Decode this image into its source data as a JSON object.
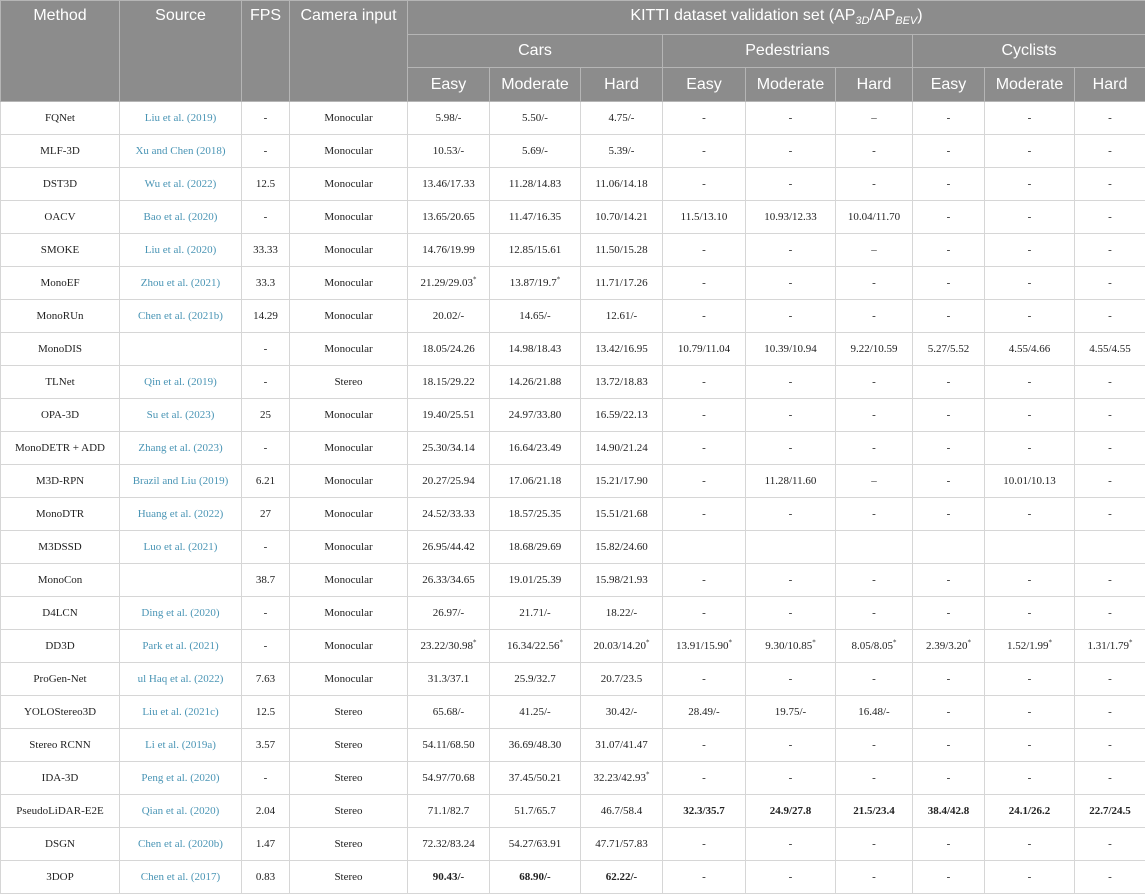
{
  "headers": {
    "method": "Method",
    "source": "Source",
    "fps": "FPS",
    "camera": "Camera input",
    "kitti_prefix": "KITTI dataset validation set (AP",
    "kitti_sub1": "3D",
    "kitti_mid": "/AP",
    "kitti_sub2": "BEV",
    "kitti_suffix": ")",
    "groups": [
      "Cars",
      "Pedestrians",
      "Cyclists"
    ],
    "levels": [
      "Easy",
      "Moderate",
      "Hard",
      "Easy",
      "Moderate",
      "Hard",
      "Easy",
      "Moderate",
      "Hard"
    ]
  },
  "rows": [
    {
      "method": "FQNet",
      "source": "Liu et al. (2019)",
      "fps": "-",
      "camera": "Monocular",
      "values": [
        "5.98/-",
        "5.50/-",
        "4.75/-",
        "-",
        "-",
        "–",
        "-",
        "-",
        "-"
      ],
      "bold": []
    },
    {
      "method": "MLF-3D",
      "source": "Xu and Chen (2018)",
      "fps": "-",
      "camera": "Monocular",
      "values": [
        "10.53/-",
        "5.69/-",
        "5.39/-",
        "-",
        "-",
        "-",
        "-",
        "-",
        "-"
      ],
      "bold": []
    },
    {
      "method": "DST3D",
      "source": "Wu et al. (2022)",
      "fps": "12.5",
      "camera": "Monocular",
      "values": [
        "13.46/17.33",
        "11.28/14.83",
        "11.06/14.18",
        "-",
        "-",
        "-",
        "-",
        "-",
        "-"
      ],
      "bold": []
    },
    {
      "method": "OACV",
      "source": "Bao et al. (2020)",
      "fps": "-",
      "camera": "Monocular",
      "values": [
        "13.65/20.65",
        "11.47/16.35",
        "10.70/14.21",
        "11.5/13.10",
        "10.93/12.33",
        "10.04/11.70",
        "-",
        "-",
        "-"
      ],
      "bold": []
    },
    {
      "method": "SMOKE",
      "source": "Liu et al. (2020)",
      "fps": "33.33",
      "camera": "Monocular",
      "values": [
        "14.76/19.99",
        "12.85/15.61",
        "11.50/15.28",
        "-",
        "-",
        "–",
        "-",
        "-",
        "-"
      ],
      "bold": []
    },
    {
      "method": "MonoEF",
      "source": "Zhou et al. (2021)",
      "fps": "33.3",
      "camera": "Monocular",
      "values": [
        "21.29/29.03*",
        "13.87/19.7*",
        "11.71/17.26",
        "-",
        "-",
        "-",
        "-",
        "-",
        "-"
      ],
      "bold": []
    },
    {
      "method": "MonoRUn",
      "source": "Chen et al. (2021b)",
      "fps": "14.29",
      "camera": "Monocular",
      "values": [
        "20.02/-",
        "14.65/-",
        "12.61/-",
        "-",
        "-",
        "-",
        "-",
        "-",
        "-"
      ],
      "bold": []
    },
    {
      "method": "MonoDIS",
      "source": "",
      "fps": "-",
      "camera": "Monocular",
      "values": [
        "18.05/24.26",
        "14.98/18.43",
        "13.42/16.95",
        "10.79/11.04",
        "10.39/10.94",
        "9.22/10.59",
        "5.27/5.52",
        "4.55/4.66",
        "4.55/4.55"
      ],
      "bold": []
    },
    {
      "method": "TLNet",
      "source": "Qin et al. (2019)",
      "fps": "-",
      "camera": "Stereo",
      "values": [
        "18.15/29.22",
        "14.26/21.88",
        "13.72/18.83",
        "-",
        "-",
        "-",
        "-",
        "-",
        "-"
      ],
      "bold": []
    },
    {
      "method": "OPA-3D",
      "source": "Su et al. (2023)",
      "fps": "25",
      "camera": "Monocular",
      "values": [
        "19.40/25.51",
        "24.97/33.80",
        "16.59/22.13",
        "-",
        "-",
        "-",
        "-",
        "-",
        "-"
      ],
      "bold": []
    },
    {
      "method": "MonoDETR + ADD",
      "source": "Zhang et al. (2023)",
      "fps": "-",
      "camera": "Monocular",
      "values": [
        "25.30/34.14",
        "16.64/23.49",
        "14.90/21.24",
        "-",
        "-",
        "-",
        "-",
        "-",
        "-"
      ],
      "bold": []
    },
    {
      "method": "M3D-RPN",
      "source": "Brazil and Liu (2019)",
      "fps": "6.21",
      "camera": "Monocular",
      "values": [
        "20.27/25.94",
        "17.06/21.18",
        "15.21/17.90",
        "-",
        "11.28/11.60",
        "–",
        "-",
        "10.01/10.13",
        "-"
      ],
      "bold": []
    },
    {
      "method": "MonoDTR",
      "source": "Huang et al. (2022)",
      "fps": "27",
      "camera": "Monocular",
      "values": [
        "24.52/33.33",
        "18.57/25.35",
        "15.51/21.68",
        "-",
        "-",
        "-",
        "-",
        "-",
        "-"
      ],
      "bold": []
    },
    {
      "method": "M3DSSD",
      "source": "Luo et al. (2021)",
      "fps": "-",
      "camera": "Monocular",
      "values": [
        "26.95/44.42",
        "18.68/29.69",
        "15.82/24.60",
        "",
        "",
        "",
        "",
        "",
        ""
      ],
      "bold": []
    },
    {
      "method": "MonoCon",
      "source": "",
      "fps": "38.7",
      "camera": "Monocular",
      "values": [
        "26.33/34.65",
        "19.01/25.39",
        "15.98/21.93",
        "-",
        "-",
        "-",
        "-",
        "-",
        "-"
      ],
      "bold": []
    },
    {
      "method": "D4LCN",
      "source": "Ding et al. (2020)",
      "fps": "-",
      "camera": "Monocular",
      "values": [
        "26.97/-",
        "21.71/-",
        "18.22/-",
        "-",
        "-",
        "-",
        "-",
        "-",
        "-"
      ],
      "bold": []
    },
    {
      "method": "DD3D",
      "source": "Park et al. (2021)",
      "fps": "-",
      "camera": "Monocular",
      "values": [
        "23.22/30.98*",
        "16.34/22.56*",
        "20.03/14.20*",
        "13.91/15.90*",
        "9.30/10.85*",
        "8.05/8.05*",
        "2.39/3.20*",
        "1.52/1.99*",
        "1.31/1.79*"
      ],
      "bold": []
    },
    {
      "method": "ProGen-Net",
      "source": "ul Haq et al. (2022)",
      "fps": "7.63",
      "camera": "Monocular",
      "values": [
        "31.3/37.1",
        "25.9/32.7",
        "20.7/23.5",
        "-",
        "-",
        "-",
        "-",
        "-",
        "-"
      ],
      "bold": []
    },
    {
      "method": "YOLOStereo3D",
      "source": "Liu et al. (2021c)",
      "fps": "12.5",
      "camera": "Stereo",
      "values": [
        "65.68/-",
        "41.25/-",
        "30.42/-",
        "28.49/-",
        "19.75/-",
        "16.48/-",
        "-",
        "-",
        "-"
      ],
      "bold": []
    },
    {
      "method": "Stereo RCNN",
      "source": "Li et al. (2019a)",
      "fps": "3.57",
      "camera": "Stereo",
      "values": [
        "54.11/68.50",
        "36.69/48.30",
        "31.07/41.47",
        "-",
        "-",
        "-",
        "-",
        "-",
        "-"
      ],
      "bold": []
    },
    {
      "method": "IDA-3D",
      "source": "Peng et al. (2020)",
      "fps": "-",
      "camera": "Stereo",
      "values": [
        "54.97/70.68",
        "37.45/50.21",
        "32.23/42.93*",
        "-",
        "-",
        "-",
        "-",
        "-",
        "-"
      ],
      "bold": []
    },
    {
      "method": "PseudoLiDAR-E2E",
      "source": "Qian et al. (2020)",
      "fps": "2.04",
      "camera": "Stereo",
      "values": [
        "71.1/82.7",
        "51.7/65.7",
        "46.7/58.4",
        "32.3/35.7",
        "24.9/27.8",
        "21.5/23.4",
        "38.4/42.8",
        "24.1/26.2",
        "22.7/24.5"
      ],
      "bold": [
        3,
        4,
        5,
        6,
        7,
        8
      ]
    },
    {
      "method": "DSGN",
      "source": "Chen et al. (2020b)",
      "fps": "1.47",
      "camera": "Stereo",
      "values": [
        "72.32/83.24",
        "54.27/63.91",
        "47.71/57.83",
        "-",
        "-",
        "-",
        "-",
        "-",
        "-"
      ],
      "bold": []
    },
    {
      "method": "3DOP",
      "source": "Chen et al. (2017)",
      "fps": "0.83",
      "camera": "Stereo",
      "values": [
        "90.43/-",
        "68.90/-",
        "62.22/-",
        "-",
        "-",
        "-",
        "-",
        "-",
        "-"
      ],
      "bold": [
        0,
        1,
        2
      ]
    }
  ]
}
